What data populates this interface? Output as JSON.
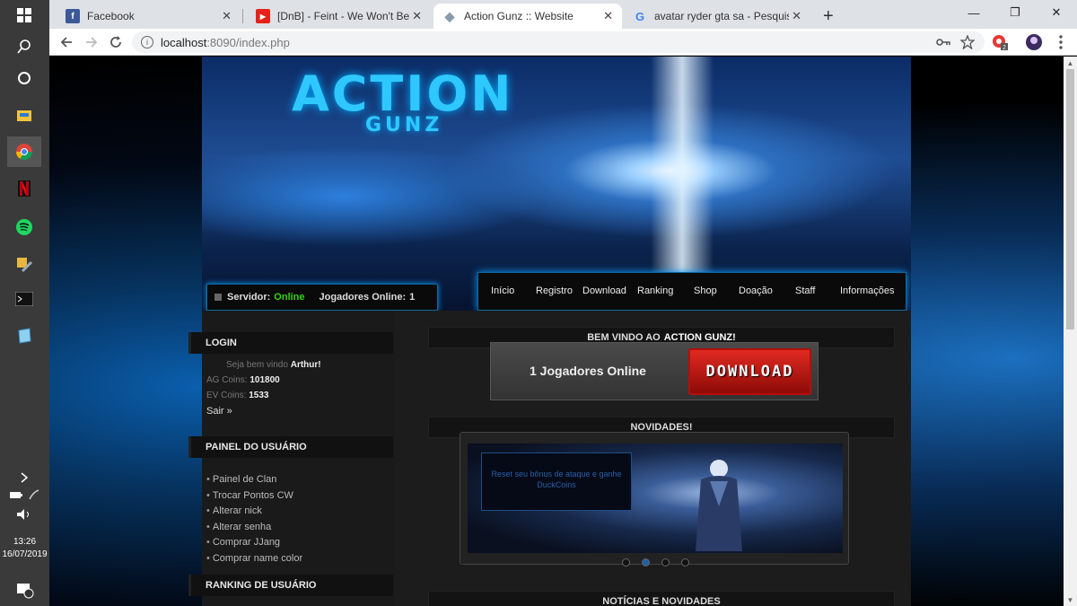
{
  "taskbar": {
    "icons": [
      "windows-icon",
      "search-icon",
      "cortana-icon",
      "file-explorer-icon",
      "chrome-icon",
      "netflix-icon",
      "spotify-icon",
      "tools-icon",
      "terminal-icon",
      "notepad-icon"
    ],
    "time": "13:26",
    "date": "16/07/2019",
    "notification_count": "1"
  },
  "browser": {
    "tabs": [
      {
        "title": "Facebook",
        "favicon": "f",
        "color": "#3b5998"
      },
      {
        "title": "[DnB] - Feint - We Won't Be Alon",
        "favicon": "▶",
        "color": "#e62117"
      },
      {
        "title": "Action Gunz :: Website",
        "favicon": "◆",
        "color": "#8a9aa8"
      },
      {
        "title": "avatar ryder gta sa - Pesquisa Go",
        "favicon": "G",
        "color": "#4285f4"
      }
    ],
    "url_host": "localhost",
    "url_rest": ":8090/index.php",
    "extension_badge": "2"
  },
  "site": {
    "logo_main": "ACTION",
    "logo_sub": "GUNZ",
    "status": {
      "server_label": "Servidor:",
      "server_value": "Online",
      "players_label": "Jogadores Online:",
      "players_value": "1"
    },
    "menu": [
      "Início",
      "Registro",
      "Download",
      "Ranking",
      "Shop",
      "Doação",
      "Staff",
      "Informações"
    ],
    "login": {
      "title": "LOGIN",
      "welcome": "Seja bem vindo",
      "user": "Arthur!",
      "ag_label": "AG Coins:",
      "ag_value": "101800",
      "ev_label": "EV Coins:",
      "ev_value": "1533",
      "logout": "Sair »"
    },
    "panel": {
      "title": "PAINEL DO USUÁRIO",
      "links": [
        "Painel de Clan",
        "Trocar Pontos CW",
        "Alterar nick",
        "Alterar senha",
        "Comprar JJang",
        "Comprar name color"
      ]
    },
    "ranking_title": "RANKING DE USUÁRIO",
    "welcome_prefix": "BEM VINDO AO",
    "welcome_name": "ACTION GUNZ!",
    "online_text": "1 Jogadores Online",
    "download_btn": "DOWNLOAD",
    "news_title": "NOVIDADES!",
    "slide_caption": "Reset seu bônus de ataque e ganhe DuckCoins",
    "news_title_2": "NOTÍCIAS E NOVIDADES"
  }
}
